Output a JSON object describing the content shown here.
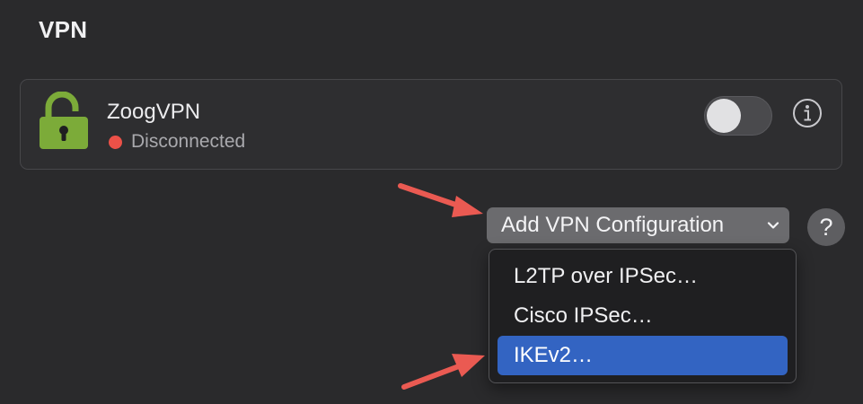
{
  "section": {
    "title": "VPN"
  },
  "vpn_service": {
    "name": "ZoogVPN",
    "status": "Disconnected",
    "status_color": "#ec5148",
    "lock_color": "#7cab39",
    "toggle_on": false
  },
  "add_configuration": {
    "label": "Add VPN Configuration"
  },
  "help": {
    "label": "?"
  },
  "menu": {
    "items": [
      {
        "label": "L2TP over IPSec…",
        "selected": false
      },
      {
        "label": "Cisco IPSec…",
        "selected": false
      },
      {
        "label": "IKEv2…",
        "selected": true
      }
    ],
    "highlight_color": "#3364c2"
  },
  "annotation": {
    "arrow_color": "#ea5a52"
  }
}
